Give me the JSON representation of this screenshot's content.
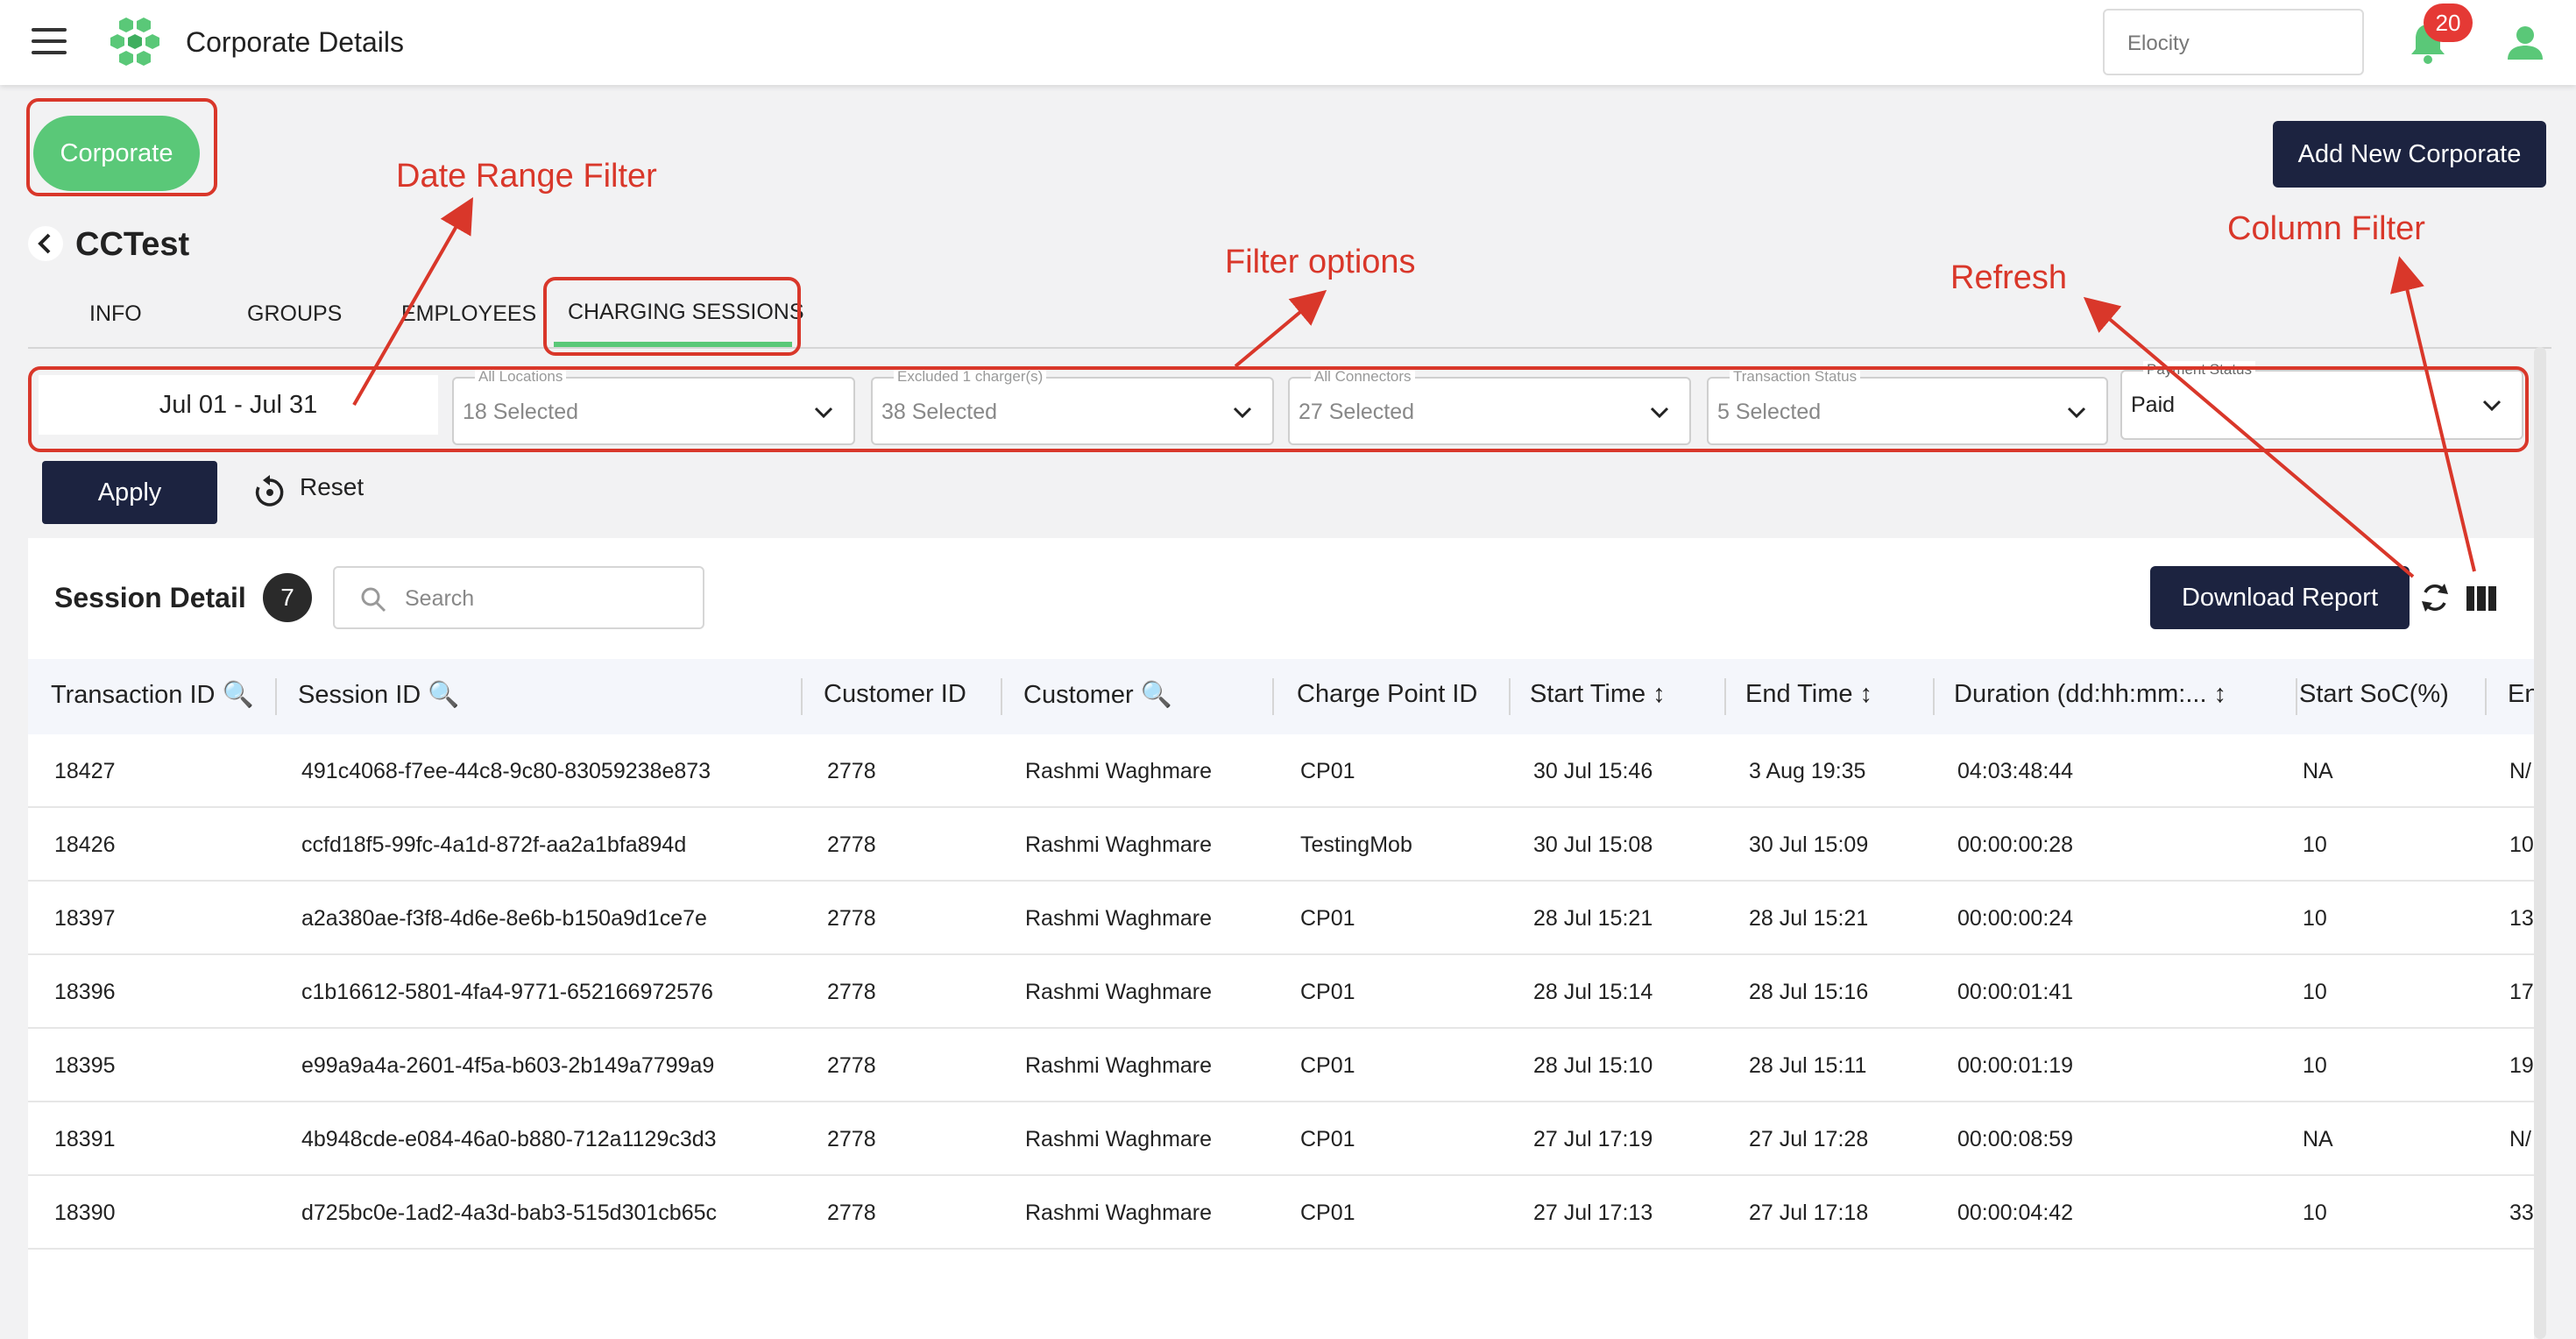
{
  "header": {
    "title": "Corporate Details",
    "tenant_placeholder": "Elocity",
    "notifications_count": "20"
  },
  "actions": {
    "corporate_label": "Corporate",
    "add_new_label": "Add New Corporate"
  },
  "page": {
    "name": "CCTest"
  },
  "tabs": [
    {
      "label": "INFO"
    },
    {
      "label": "GROUPS"
    },
    {
      "label": "EMPLOYEES"
    },
    {
      "label": "CHARGING SESSIONS",
      "active": true
    }
  ],
  "filters": {
    "date_range": "Jul 01 - Jul 31",
    "locations": {
      "label": "All Locations",
      "value": "18 Selected"
    },
    "chargers": {
      "label": "Excluded 1 charger(s)",
      "value": "38 Selected"
    },
    "connectors": {
      "label": "All Connectors",
      "value": "27 Selected"
    },
    "transaction_status": {
      "label": "Transaction Status",
      "value": "5 Selected"
    },
    "payment_status": {
      "label": "Payment Status",
      "value": "Paid"
    },
    "apply_label": "Apply",
    "reset_label": "Reset"
  },
  "session": {
    "title": "Session Detail",
    "count": "7",
    "search_placeholder": "Search",
    "download_label": "Download Report"
  },
  "table": {
    "columns": [
      "Transaction ID",
      "Session ID",
      "Customer ID",
      "Customer",
      "Charge Point ID",
      "Start Time",
      "End Time",
      "Duration (dd:hh:mm:...",
      "Start SoC(%)",
      "En"
    ],
    "rows": [
      [
        "18427",
        "491c4068-f7ee-44c8-9c80-83059238e873",
        "2778",
        "Rashmi Waghmare",
        "CP01",
        "30 Jul 15:46",
        "3 Aug 19:35",
        "04:03:48:44",
        "NA",
        "N/"
      ],
      [
        "18426",
        "ccfd18f5-99fc-4a1d-872f-aa2a1bfa894d",
        "2778",
        "Rashmi Waghmare",
        "TestingMob",
        "30 Jul 15:08",
        "30 Jul 15:09",
        "00:00:00:28",
        "10",
        "10"
      ],
      [
        "18397",
        "a2a380ae-f3f8-4d6e-8e6b-b150a9d1ce7e",
        "2778",
        "Rashmi Waghmare",
        "CP01",
        "28 Jul 15:21",
        "28 Jul 15:21",
        "00:00:00:24",
        "10",
        "13"
      ],
      [
        "18396",
        "c1b16612-5801-4fa4-9771-652166972576",
        "2778",
        "Rashmi Waghmare",
        "CP01",
        "28 Jul 15:14",
        "28 Jul 15:16",
        "00:00:01:41",
        "10",
        "17"
      ],
      [
        "18395",
        "e99a9a4a-2601-4f5a-b603-2b149a7799a9",
        "2778",
        "Rashmi Waghmare",
        "CP01",
        "28 Jul 15:10",
        "28 Jul 15:11",
        "00:00:01:19",
        "10",
        "19"
      ],
      [
        "18391",
        "4b948cde-e084-46a0-b880-712a1129c3d3",
        "2778",
        "Rashmi Waghmare",
        "CP01",
        "27 Jul 17:19",
        "27 Jul 17:28",
        "00:00:08:59",
        "NA",
        "N/"
      ],
      [
        "18390",
        "d725bc0e-1ad2-4a3d-bab3-515d301cb65c",
        "2778",
        "Rashmi Waghmare",
        "CP01",
        "27 Jul 17:13",
        "27 Jul 17:18",
        "00:00:04:42",
        "10",
        "33"
      ]
    ]
  },
  "annotations": {
    "date_range": "Date Range Filter",
    "filter_options": "Filter options",
    "refresh": "Refresh",
    "column_filter": "Column Filter"
  },
  "colors": {
    "brand_green": "#5ac878",
    "navy": "#1c2340",
    "annotation_red": "#d9372a",
    "badge_red": "#e53935"
  }
}
